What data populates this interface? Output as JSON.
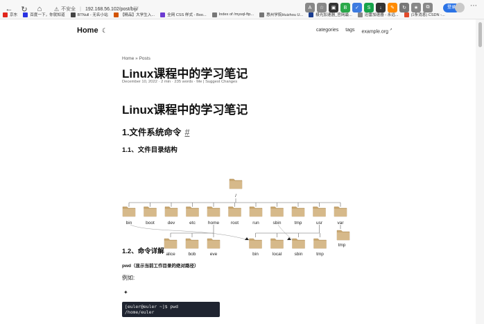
{
  "browser": {
    "url": "192.168.56.102/post/biji/",
    "insecure_label": "不安全",
    "login_label": "登录",
    "bookmarks": [
      {
        "label": "京东",
        "color": "#e1251b"
      },
      {
        "label": "百度一下，你就知道",
        "color": "#2932e1"
      },
      {
        "label": "BTNull - 无名小站",
        "color": "#444444"
      },
      {
        "label": "【精品】大学生入...",
        "color": "#d35400"
      },
      {
        "label": "全网 CSS 样式 - Boo...",
        "color": "#6c3bd1"
      },
      {
        "label": "Index of /mysql-ftp...",
        "color": "#777777"
      },
      {
        "label": "惠州学院Huizhou U...",
        "color": "#777777"
      },
      {
        "label": "极光加速器_官网最...",
        "color": "#1a3d8f"
      },
      {
        "label": "迅雷加速器 - 永远...",
        "color": "#888888"
      },
      {
        "label": "(1条消息) CSDN -...",
        "color": "#e24a2b"
      }
    ],
    "tool_icons": [
      {
        "name": "read-aloud-icon",
        "glyph": "A",
        "color": "#888888"
      },
      {
        "name": "favorite-star-icon",
        "glyph": "☆",
        "color": "#888888"
      },
      {
        "name": "extension-1-icon",
        "glyph": "▣",
        "color": "#333333"
      },
      {
        "name": "extension-2-icon",
        "glyph": "B",
        "color": "#2aa84a"
      },
      {
        "name": "extension-3-icon",
        "glyph": "✓",
        "color": "#3d7be0"
      },
      {
        "name": "extension-4-icon",
        "glyph": "S",
        "color": "#16a34a"
      },
      {
        "name": "extension-5-icon",
        "glyph": "↓",
        "color": "#333333"
      },
      {
        "name": "extension-6-icon",
        "glyph": "✎",
        "color": "#ff8a00"
      },
      {
        "name": "refresh-ext-icon",
        "glyph": "↻",
        "color": "#777777"
      },
      {
        "name": "favorites-bar-icon",
        "glyph": "★",
        "color": "#888888"
      },
      {
        "name": "collections-icon",
        "glyph": "⧉",
        "color": "#888888"
      }
    ]
  },
  "site": {
    "home_label": "Home",
    "menu": [
      {
        "label": "categories"
      },
      {
        "label": "tags"
      },
      {
        "label": "example.org"
      }
    ]
  },
  "post": {
    "breadcrumb": "Home » Posts",
    "title": "Linux课程中的学习笔记",
    "meta": "December 10, 2022 · 2 min · 235 words · Me | Suggest Changes",
    "heading_main": "Linux课程中的学习笔记",
    "heading_1": "1.文件系统命令",
    "heading_1_anchor": "#",
    "heading_11": "1.1、文件目录结构",
    "heading_12": "1.2、命令详解",
    "pwd_label": "pwd（显示当前工作目录的绝对路径）",
    "example_label": "例如:",
    "star_glyph": "✦",
    "code_lines": [
      "[euler@euler ~]$ pwd",
      "/home/euler"
    ]
  },
  "tree": {
    "root": "/",
    "dirs": [
      "bin",
      "boot",
      "dev",
      "etc",
      "home",
      "root",
      "run",
      "sbin",
      "tmp",
      "usr",
      "var"
    ],
    "home_children": [
      "alice",
      "bob",
      "eve"
    ],
    "usr_children": [
      "bin",
      "local",
      "sbin",
      "tmp"
    ],
    "var_children": [
      "tmp"
    ],
    "folder_color": "#c9a872"
  }
}
